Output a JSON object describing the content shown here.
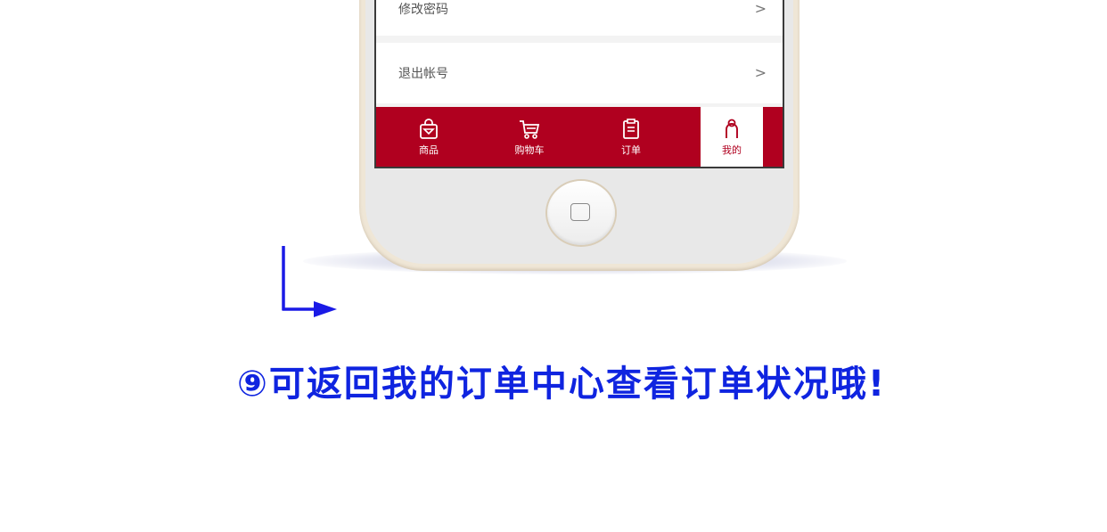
{
  "settings": {
    "change_password_label": "修改密码",
    "logout_label": "退出帐号",
    "chevron": ">"
  },
  "tabbar": {
    "items": [
      {
        "label": "商品",
        "icon": "shopping-bag-icon"
      },
      {
        "label": "购物车",
        "icon": "cart-icon"
      },
      {
        "label": "订单",
        "icon": "clipboard-icon"
      },
      {
        "label": "我的",
        "icon": "user-icon",
        "active": true
      }
    ]
  },
  "caption": {
    "text": "⑨可返回我的订单中心查看订单状况哦!"
  },
  "colors": {
    "tabbar_bg": "#b0001f",
    "caption": "#0f24e0",
    "arrow": "#1a1ae6"
  }
}
